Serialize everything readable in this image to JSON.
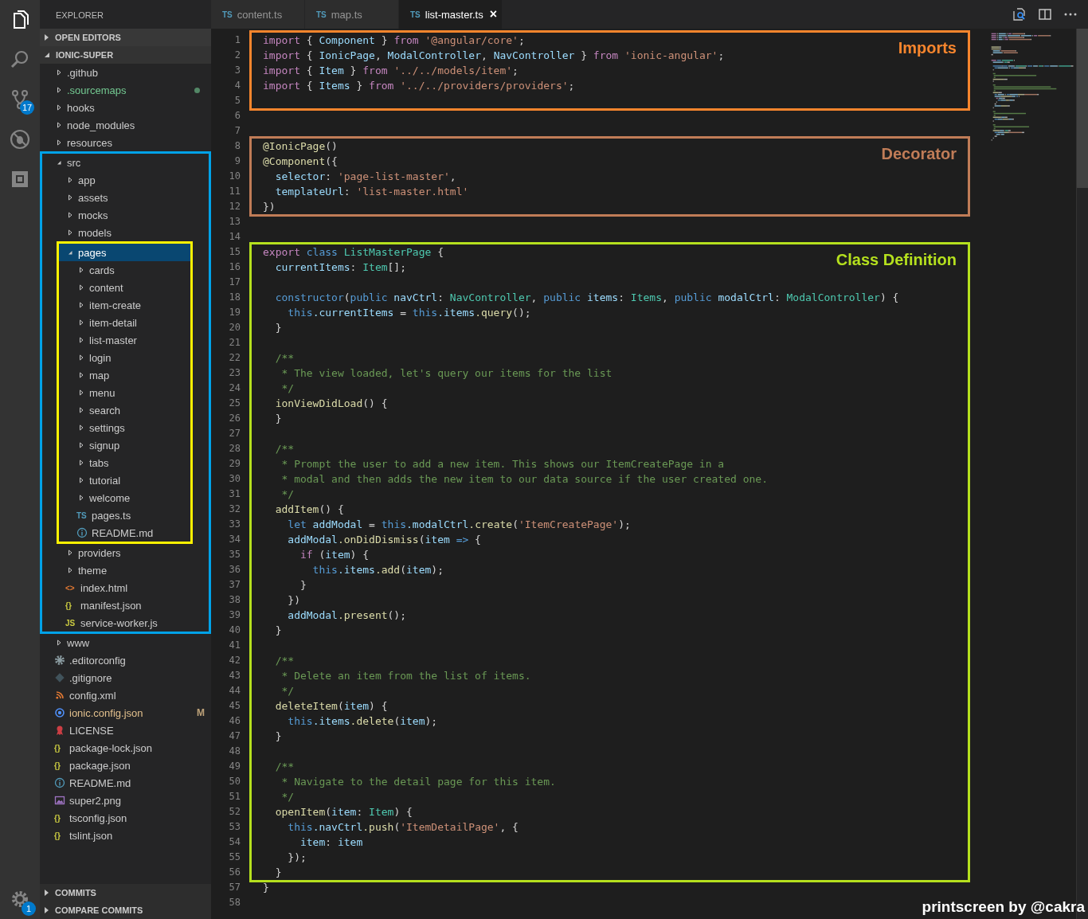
{
  "activity_bar": {
    "items": [
      {
        "kind": "files",
        "selected": true
      },
      {
        "kind": "search",
        "selected": false
      },
      {
        "kind": "source-control",
        "selected": false,
        "badge": "17"
      },
      {
        "kind": "debug",
        "selected": false
      },
      {
        "kind": "extensions",
        "selected": false
      }
    ],
    "settings": {
      "badge": "1"
    }
  },
  "sidebar": {
    "title": "EXPLORER",
    "sections": [
      {
        "title": "OPEN EDITORS",
        "expanded": false
      },
      {
        "title": "IONIC-SUPER",
        "expanded": true,
        "tree": [
          {
            "name": ".github",
            "kind": "folder",
            "expanded": false,
            "selected": false
          },
          {
            "name": ".sourcemaps",
            "kind": "folder",
            "expanded": false,
            "selected": false,
            "color": "#73c991"
          },
          {
            "name": "hooks",
            "kind": "folder",
            "expanded": false,
            "selected": false
          },
          {
            "name": "node_modules",
            "kind": "folder",
            "expanded": false,
            "selected": false
          },
          {
            "name": "resources",
            "kind": "folder",
            "expanded": false,
            "selected": false
          },
          {
            "name": "src",
            "kind": "folder",
            "expanded": true,
            "selected": false,
            "frame": {
              "color": "#00a2e8"
            },
            "children": [
              {
                "name": "app",
                "kind": "folder",
                "expanded": false,
                "selected": false
              },
              {
                "name": "assets",
                "kind": "folder",
                "expanded": false,
                "selected": false
              },
              {
                "name": "mocks",
                "kind": "folder",
                "expanded": false,
                "selected": false
              },
              {
                "name": "models",
                "kind": "folder",
                "expanded": false,
                "selected": false
              },
              {
                "name": "pages",
                "kind": "folder",
                "expanded": true,
                "selected": true,
                "frame": {
                  "color": "#fff200"
                },
                "children": [
                  {
                    "name": "cards",
                    "kind": "folder",
                    "expanded": false,
                    "selected": false
                  },
                  {
                    "name": "content",
                    "kind": "folder",
                    "expanded": false,
                    "selected": false
                  },
                  {
                    "name": "item-create",
                    "kind": "folder",
                    "expanded": false,
                    "selected": false
                  },
                  {
                    "name": "item-detail",
                    "kind": "folder",
                    "expanded": false,
                    "selected": false
                  },
                  {
                    "name": "list-master",
                    "kind": "folder",
                    "expanded": false,
                    "selected": false
                  },
                  {
                    "name": "login",
                    "kind": "folder",
                    "expanded": false,
                    "selected": false
                  },
                  {
                    "name": "map",
                    "kind": "folder",
                    "expanded": false,
                    "selected": false
                  },
                  {
                    "name": "menu",
                    "kind": "folder",
                    "expanded": false,
                    "selected": false
                  },
                  {
                    "name": "search",
                    "kind": "folder",
                    "expanded": false,
                    "selected": false
                  },
                  {
                    "name": "settings",
                    "kind": "folder",
                    "expanded": false,
                    "selected": false
                  },
                  {
                    "name": "signup",
                    "kind": "folder",
                    "expanded": false,
                    "selected": false
                  },
                  {
                    "name": "tabs",
                    "kind": "folder",
                    "expanded": false,
                    "selected": false
                  },
                  {
                    "name": "tutorial",
                    "kind": "folder",
                    "expanded": false,
                    "selected": false
                  },
                  {
                    "name": "welcome",
                    "kind": "folder",
                    "expanded": false,
                    "selected": false
                  },
                  {
                    "name": "pages.ts",
                    "kind": "ts",
                    "icon_label": "TS",
                    "selected": false
                  },
                  {
                    "name": "README.md",
                    "kind": "info",
                    "selected": false
                  }
                ]
              },
              {
                "name": "providers",
                "kind": "folder",
                "expanded": false,
                "selected": false
              },
              {
                "name": "theme",
                "kind": "folder",
                "expanded": false,
                "selected": false
              },
              {
                "name": "index.html",
                "kind": "html",
                "icon_label": "<>",
                "selected": false
              },
              {
                "name": "manifest.json",
                "kind": "json",
                "icon_label": "{}",
                "selected": false
              },
              {
                "name": "service-worker.js",
                "kind": "js",
                "icon_label": "JS",
                "selected": false
              }
            ]
          },
          {
            "name": "www",
            "kind": "folder",
            "expanded": false,
            "selected": false
          },
          {
            "name": ".editorconfig",
            "kind": "gear",
            "selected": false
          },
          {
            "name": ".gitignore",
            "kind": "git",
            "selected": false
          },
          {
            "name": "config.xml",
            "kind": "rss",
            "selected": false
          },
          {
            "name": "ionic.config.json",
            "kind": "ionic",
            "selected": false,
            "color": "#e2c08d",
            "badge": "M"
          },
          {
            "name": "LICENSE",
            "kind": "license",
            "selected": false
          },
          {
            "name": "package-lock.json",
            "kind": "json",
            "icon_label": "{}",
            "selected": false
          },
          {
            "name": "package.json",
            "kind": "json",
            "icon_label": "{}",
            "selected": false
          },
          {
            "name": "README.md",
            "kind": "info",
            "selected": false
          },
          {
            "name": "super2.png",
            "kind": "image",
            "selected": false
          },
          {
            "name": "tsconfig.json",
            "kind": "json",
            "icon_label": "{}",
            "selected": false
          },
          {
            "name": "tslint.json",
            "kind": "json",
            "icon_label": "{}",
            "selected": false
          }
        ]
      },
      {
        "title": "COMMITS",
        "expanded": false
      },
      {
        "title": "COMPARE COMMITS",
        "expanded": false
      }
    ]
  },
  "editor": {
    "tabs": [
      {
        "label": "content.ts",
        "icon_label": "TS",
        "selected": false
      },
      {
        "label": "map.ts",
        "icon_label": "TS",
        "selected": false
      },
      {
        "label": "list-master.ts",
        "icon_label": "TS",
        "selected": true,
        "close": "×"
      }
    ],
    "code_blocks": [
      {
        "annotation": {
          "label": "Imports",
          "color": "#f7852d"
        },
        "lines": [
          {
            "number": "1",
            "tokens": [
              {
                "kind": "kw",
                "text": "import"
              },
              {
                "kind": "p",
                "text": " { "
              },
              {
                "kind": "v",
                "text": "Component"
              },
              {
                "kind": "p",
                "text": " } "
              },
              {
                "kind": "kw",
                "text": "from"
              },
              {
                "kind": "s",
                "text": " '@angular/core'"
              },
              {
                "kind": "p",
                "text": ";"
              }
            ]
          },
          {
            "number": "2",
            "tokens": [
              {
                "kind": "kw",
                "text": "import"
              },
              {
                "kind": "p",
                "text": " { "
              },
              {
                "kind": "v",
                "text": "IonicPage"
              },
              {
                "kind": "p",
                "text": ", "
              },
              {
                "kind": "v",
                "text": "ModalController"
              },
              {
                "kind": "p",
                "text": ", "
              },
              {
                "kind": "v",
                "text": "NavController"
              },
              {
                "kind": "p",
                "text": " } "
              },
              {
                "kind": "kw",
                "text": "from"
              },
              {
                "kind": "s",
                "text": " 'ionic-angular'"
              },
              {
                "kind": "p",
                "text": ";"
              }
            ]
          },
          {
            "number": "3",
            "tokens": [
              {
                "kind": "kw",
                "text": "import"
              },
              {
                "kind": "p",
                "text": " { "
              },
              {
                "kind": "v",
                "text": "Item"
              },
              {
                "kind": "p",
                "text": " } "
              },
              {
                "kind": "kw",
                "text": "from"
              },
              {
                "kind": "s",
                "text": " '../../models/item'"
              },
              {
                "kind": "p",
                "text": ";"
              }
            ]
          },
          {
            "number": "4",
            "tokens": [
              {
                "kind": "kw",
                "text": "import"
              },
              {
                "kind": "p",
                "text": " { "
              },
              {
                "kind": "v",
                "text": "Items"
              },
              {
                "kind": "p",
                "text": " } "
              },
              {
                "kind": "kw",
                "text": "from"
              },
              {
                "kind": "s",
                "text": " '../../providers/providers'"
              },
              {
                "kind": "p",
                "text": ";"
              }
            ]
          },
          {
            "number": "5"
          }
        ]
      },
      {
        "lines": [
          {
            "number": "6"
          },
          {
            "number": "7"
          }
        ]
      },
      {
        "annotation": {
          "label": "Decorator",
          "color": "#c07c57"
        },
        "lines": [
          {
            "number": "8",
            "tokens": [
              {
                "kind": "fn",
                "text": "@IonicPage"
              },
              {
                "kind": "p",
                "text": "()"
              }
            ]
          },
          {
            "number": "9",
            "tokens": [
              {
                "kind": "fn",
                "text": "@Component"
              },
              {
                "kind": "p",
                "text": "({"
              }
            ]
          },
          {
            "number": "10",
            "tokens": [
              {
                "kind": "v",
                "text": "  selector"
              },
              {
                "kind": "p",
                "text": ": "
              },
              {
                "kind": "s",
                "text": "'page-list-master'"
              },
              {
                "kind": "p",
                "text": ","
              }
            ]
          },
          {
            "number": "11",
            "tokens": [
              {
                "kind": "v",
                "text": "  templateUrl"
              },
              {
                "kind": "p",
                "text": ": "
              },
              {
                "kind": "s",
                "text": "'list-master.html'"
              }
            ]
          },
          {
            "number": "12",
            "tokens": [
              {
                "kind": "p",
                "text": "})"
              }
            ]
          }
        ]
      },
      {
        "lines": [
          {
            "number": "13"
          },
          {
            "number": "14"
          }
        ]
      },
      {
        "annotation": {
          "label": "Class Definition",
          "color": "#b5e01e"
        },
        "lines": [
          {
            "number": "15",
            "tokens": [
              {
                "kind": "kw",
                "text": "export"
              },
              {
                "kind": "st",
                "text": " class"
              },
              {
                "kind": "ty",
                "text": " ListMasterPage"
              },
              {
                "kind": "p",
                "text": " {"
              }
            ]
          },
          {
            "number": "16",
            "tokens": [
              {
                "kind": "v",
                "text": "  currentItems"
              },
              {
                "kind": "p",
                "text": ": "
              },
              {
                "kind": "ty",
                "text": "Item"
              },
              {
                "kind": "p",
                "text": "[];"
              }
            ]
          },
          {
            "number": "17"
          },
          {
            "number": "18",
            "tokens": [
              {
                "kind": "st",
                "text": "  constructor"
              },
              {
                "kind": "p",
                "text": "("
              },
              {
                "kind": "st",
                "text": "public"
              },
              {
                "kind": "v",
                "text": " navCtrl"
              },
              {
                "kind": "p",
                "text": ": "
              },
              {
                "kind": "ty",
                "text": "NavController"
              },
              {
                "kind": "p",
                "text": ", "
              },
              {
                "kind": "st",
                "text": "public"
              },
              {
                "kind": "v",
                "text": " items"
              },
              {
                "kind": "p",
                "text": ": "
              },
              {
                "kind": "ty",
                "text": "Items"
              },
              {
                "kind": "p",
                "text": ", "
              },
              {
                "kind": "st",
                "text": "public"
              },
              {
                "kind": "v",
                "text": " modalCtrl"
              },
              {
                "kind": "p",
                "text": ": "
              },
              {
                "kind": "ty",
                "text": "ModalController"
              },
              {
                "kind": "p",
                "text": ") {"
              }
            ]
          },
          {
            "number": "19",
            "tokens": [
              {
                "kind": "st",
                "text": "    this"
              },
              {
                "kind": "v",
                "text": ".currentItems"
              },
              {
                "kind": "p",
                "text": " = "
              },
              {
                "kind": "st",
                "text": "this"
              },
              {
                "kind": "v",
                "text": ".items"
              },
              {
                "kind": "fn",
                "text": ".query"
              },
              {
                "kind": "p",
                "text": "();"
              }
            ]
          },
          {
            "number": "20",
            "tokens": [
              {
                "kind": "p",
                "text": "  }"
              }
            ]
          },
          {
            "number": "21"
          },
          {
            "number": "22",
            "tokens": [
              {
                "kind": "c",
                "text": "  /**"
              }
            ]
          },
          {
            "number": "23",
            "tokens": [
              {
                "kind": "c",
                "text": "   * The view loaded, let's query our items for the list"
              }
            ]
          },
          {
            "number": "24",
            "tokens": [
              {
                "kind": "c",
                "text": "   */"
              }
            ]
          },
          {
            "number": "25",
            "tokens": [
              {
                "kind": "fn",
                "text": "  ionViewDidLoad"
              },
              {
                "kind": "p",
                "text": "() {"
              }
            ]
          },
          {
            "number": "26",
            "tokens": [
              {
                "kind": "p",
                "text": "  }"
              }
            ]
          },
          {
            "number": "27"
          },
          {
            "number": "28",
            "tokens": [
              {
                "kind": "c",
                "text": "  /**"
              }
            ]
          },
          {
            "number": "29",
            "tokens": [
              {
                "kind": "c",
                "text": "   * Prompt the user to add a new item. This shows our ItemCreatePage in a"
              }
            ]
          },
          {
            "number": "30",
            "tokens": [
              {
                "kind": "c",
                "text": "   * modal and then adds the new item to our data source if the user created one."
              }
            ]
          },
          {
            "number": "31",
            "tokens": [
              {
                "kind": "c",
                "text": "   */"
              }
            ]
          },
          {
            "number": "32",
            "tokens": [
              {
                "kind": "fn",
                "text": "  addItem"
              },
              {
                "kind": "p",
                "text": "() {"
              }
            ]
          },
          {
            "number": "33",
            "tokens": [
              {
                "kind": "st",
                "text": "    let"
              },
              {
                "kind": "v",
                "text": " addModal"
              },
              {
                "kind": "p",
                "text": " = "
              },
              {
                "kind": "st",
                "text": "this"
              },
              {
                "kind": "v",
                "text": ".modalCtrl"
              },
              {
                "kind": "fn",
                "text": ".create"
              },
              {
                "kind": "p",
                "text": "("
              },
              {
                "kind": "s",
                "text": "'ItemCreatePage'"
              },
              {
                "kind": "p",
                "text": ");"
              }
            ]
          },
          {
            "number": "34",
            "tokens": [
              {
                "kind": "v",
                "text": "    addModal"
              },
              {
                "kind": "fn",
                "text": ".onDidDismiss"
              },
              {
                "kind": "p",
                "text": "("
              },
              {
                "kind": "v",
                "text": "item"
              },
              {
                "kind": "st",
                "text": " =>"
              },
              {
                "kind": "p",
                "text": " {"
              }
            ]
          },
          {
            "number": "35",
            "tokens": [
              {
                "kind": "kw",
                "text": "      if"
              },
              {
                "kind": "p",
                "text": " ("
              },
              {
                "kind": "v",
                "text": "item"
              },
              {
                "kind": "p",
                "text": ") {"
              }
            ]
          },
          {
            "number": "36",
            "tokens": [
              {
                "kind": "st",
                "text": "        this"
              },
              {
                "kind": "v",
                "text": ".items"
              },
              {
                "kind": "fn",
                "text": ".add"
              },
              {
                "kind": "p",
                "text": "("
              },
              {
                "kind": "v",
                "text": "item"
              },
              {
                "kind": "p",
                "text": ");"
              }
            ]
          },
          {
            "number": "37",
            "tokens": [
              {
                "kind": "p",
                "text": "      }"
              }
            ]
          },
          {
            "number": "38",
            "tokens": [
              {
                "kind": "p",
                "text": "    })"
              }
            ]
          },
          {
            "number": "39",
            "tokens": [
              {
                "kind": "v",
                "text": "    addModal"
              },
              {
                "kind": "fn",
                "text": ".present"
              },
              {
                "kind": "p",
                "text": "();"
              }
            ]
          },
          {
            "number": "40",
            "tokens": [
              {
                "kind": "p",
                "text": "  }"
              }
            ]
          },
          {
            "number": "41"
          },
          {
            "number": "42",
            "tokens": [
              {
                "kind": "c",
                "text": "  /**"
              }
            ]
          },
          {
            "number": "43",
            "tokens": [
              {
                "kind": "c",
                "text": "   * Delete an item from the list of items."
              }
            ]
          },
          {
            "number": "44",
            "tokens": [
              {
                "kind": "c",
                "text": "   */"
              }
            ]
          },
          {
            "number": "45",
            "tokens": [
              {
                "kind": "fn",
                "text": "  deleteItem"
              },
              {
                "kind": "p",
                "text": "("
              },
              {
                "kind": "v",
                "text": "item"
              },
              {
                "kind": "p",
                "text": ") {"
              }
            ]
          },
          {
            "number": "46",
            "tokens": [
              {
                "kind": "st",
                "text": "    this"
              },
              {
                "kind": "v",
                "text": ".items"
              },
              {
                "kind": "fn",
                "text": ".delete"
              },
              {
                "kind": "p",
                "text": "("
              },
              {
                "kind": "v",
                "text": "item"
              },
              {
                "kind": "p",
                "text": ");"
              }
            ]
          },
          {
            "number": "47",
            "tokens": [
              {
                "kind": "p",
                "text": "  }"
              }
            ]
          },
          {
            "number": "48"
          },
          {
            "number": "49",
            "tokens": [
              {
                "kind": "c",
                "text": "  /**"
              }
            ]
          },
          {
            "number": "50",
            "tokens": [
              {
                "kind": "c",
                "text": "   * Navigate to the detail page for this item."
              }
            ]
          },
          {
            "number": "51",
            "tokens": [
              {
                "kind": "c",
                "text": "   */"
              }
            ]
          },
          {
            "number": "52",
            "tokens": [
              {
                "kind": "fn",
                "text": "  openItem"
              },
              {
                "kind": "p",
                "text": "("
              },
              {
                "kind": "v",
                "text": "item"
              },
              {
                "kind": "p",
                "text": ": "
              },
              {
                "kind": "ty",
                "text": "Item"
              },
              {
                "kind": "p",
                "text": ") {"
              }
            ]
          },
          {
            "number": "53",
            "tokens": [
              {
                "kind": "st",
                "text": "    this"
              },
              {
                "kind": "v",
                "text": ".navCtrl"
              },
              {
                "kind": "fn",
                "text": ".push"
              },
              {
                "kind": "p",
                "text": "("
              },
              {
                "kind": "s",
                "text": "'ItemDetailPage'"
              },
              {
                "kind": "p",
                "text": ", {"
              }
            ]
          },
          {
            "number": "54",
            "tokens": [
              {
                "kind": "v",
                "text": "      item"
              },
              {
                "kind": "p",
                "text": ": "
              },
              {
                "kind": "v",
                "text": "item"
              }
            ]
          },
          {
            "number": "55",
            "tokens": [
              {
                "kind": "p",
                "text": "    });"
              }
            ]
          },
          {
            "number": "56",
            "tokens": [
              {
                "kind": "p",
                "text": "  }"
              }
            ]
          }
        ]
      },
      {
        "lines": [
          {
            "number": "57",
            "tokens": [
              {
                "kind": "p",
                "text": "}"
              }
            ]
          },
          {
            "number": "58"
          }
        ]
      }
    ]
  },
  "credit": "printscreen by @cakra"
}
